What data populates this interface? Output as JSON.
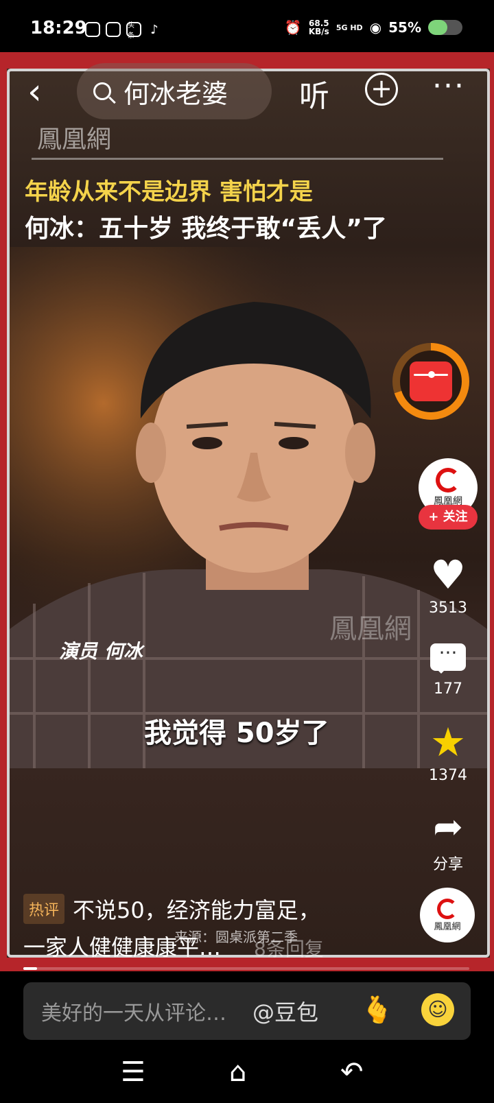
{
  "status_bar": {
    "time": "18:29",
    "app_icons": [
      "app-icon-1",
      "app-icon-2",
      "toutiao-icon",
      "tiktok-icon"
    ],
    "app_icon_labels": [
      "",
      "",
      "头条",
      "♪"
    ],
    "net_speed_value": "68.5",
    "net_speed_unit": "KB/s",
    "signal": "5G HD",
    "battery_percent": "55%",
    "battery_level": 0.55
  },
  "top_nav": {
    "back_glyph": "‹",
    "search_query": "何冰老婆",
    "listen_label": "听",
    "add_glyph": "+",
    "more_glyph": "···"
  },
  "video": {
    "channel_watermark": "鳳凰網",
    "headline_line1": "年龄从来不是边界  害怕才是",
    "headline_line2": "何冰：五十岁 我终于敢“丢人”了",
    "speaker_caption": "演员 何冰",
    "subtitle": "我觉得 50岁了",
    "corner_watermark": "鳳凰網"
  },
  "right_rail": {
    "creator_name": "鳳凰網",
    "follow_label": "+ 关注",
    "like_count": "3513",
    "comment_count": "177",
    "favorite_count": "1374",
    "share_label": "分享",
    "music_label": "鳳凰網"
  },
  "caption": {
    "hot_tag": "热评",
    "hot_line1": "不说50，经济能力富足，",
    "hot_line2": "一家人健健康康平…",
    "source": "来源：圆桌派第二季",
    "reply_count": "8条回复"
  },
  "progress": {
    "fraction": 0.03
  },
  "comment_bar": {
    "placeholder": "美好的一天从评论…",
    "mention": "@豆包"
  },
  "nav_bar": {
    "menu_glyph": "☰",
    "home_glyph": "⌂",
    "back_glyph": "↶"
  }
}
